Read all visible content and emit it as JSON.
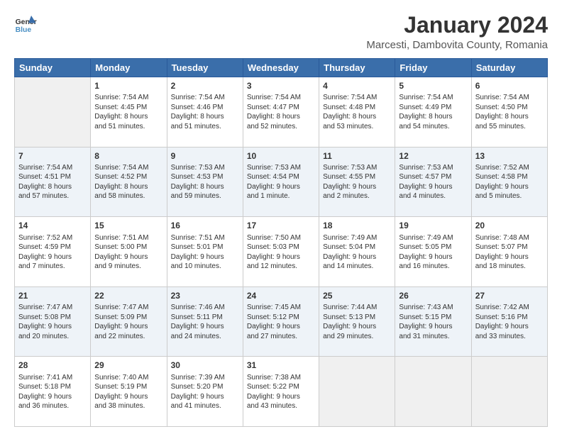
{
  "header": {
    "logo": {
      "line1": "General",
      "line2": "Blue"
    },
    "title": "January 2024",
    "subtitle": "Marcesti, Dambovita County, Romania"
  },
  "calendar": {
    "headers": [
      "Sunday",
      "Monday",
      "Tuesday",
      "Wednesday",
      "Thursday",
      "Friday",
      "Saturday"
    ],
    "weeks": [
      [
        {
          "day": "",
          "info": ""
        },
        {
          "day": "1",
          "info": "Sunrise: 7:54 AM\nSunset: 4:45 PM\nDaylight: 8 hours\nand 51 minutes."
        },
        {
          "day": "2",
          "info": "Sunrise: 7:54 AM\nSunset: 4:46 PM\nDaylight: 8 hours\nand 51 minutes."
        },
        {
          "day": "3",
          "info": "Sunrise: 7:54 AM\nSunset: 4:47 PM\nDaylight: 8 hours\nand 52 minutes."
        },
        {
          "day": "4",
          "info": "Sunrise: 7:54 AM\nSunset: 4:48 PM\nDaylight: 8 hours\nand 53 minutes."
        },
        {
          "day": "5",
          "info": "Sunrise: 7:54 AM\nSunset: 4:49 PM\nDaylight: 8 hours\nand 54 minutes."
        },
        {
          "day": "6",
          "info": "Sunrise: 7:54 AM\nSunset: 4:50 PM\nDaylight: 8 hours\nand 55 minutes."
        }
      ],
      [
        {
          "day": "7",
          "info": "Sunrise: 7:54 AM\nSunset: 4:51 PM\nDaylight: 8 hours\nand 57 minutes."
        },
        {
          "day": "8",
          "info": "Sunrise: 7:54 AM\nSunset: 4:52 PM\nDaylight: 8 hours\nand 58 minutes."
        },
        {
          "day": "9",
          "info": "Sunrise: 7:53 AM\nSunset: 4:53 PM\nDaylight: 8 hours\nand 59 minutes."
        },
        {
          "day": "10",
          "info": "Sunrise: 7:53 AM\nSunset: 4:54 PM\nDaylight: 9 hours\nand 1 minute."
        },
        {
          "day": "11",
          "info": "Sunrise: 7:53 AM\nSunset: 4:55 PM\nDaylight: 9 hours\nand 2 minutes."
        },
        {
          "day": "12",
          "info": "Sunrise: 7:53 AM\nSunset: 4:57 PM\nDaylight: 9 hours\nand 4 minutes."
        },
        {
          "day": "13",
          "info": "Sunrise: 7:52 AM\nSunset: 4:58 PM\nDaylight: 9 hours\nand 5 minutes."
        }
      ],
      [
        {
          "day": "14",
          "info": "Sunrise: 7:52 AM\nSunset: 4:59 PM\nDaylight: 9 hours\nand 7 minutes."
        },
        {
          "day": "15",
          "info": "Sunrise: 7:51 AM\nSunset: 5:00 PM\nDaylight: 9 hours\nand 9 minutes."
        },
        {
          "day": "16",
          "info": "Sunrise: 7:51 AM\nSunset: 5:01 PM\nDaylight: 9 hours\nand 10 minutes."
        },
        {
          "day": "17",
          "info": "Sunrise: 7:50 AM\nSunset: 5:03 PM\nDaylight: 9 hours\nand 12 minutes."
        },
        {
          "day": "18",
          "info": "Sunrise: 7:49 AM\nSunset: 5:04 PM\nDaylight: 9 hours\nand 14 minutes."
        },
        {
          "day": "19",
          "info": "Sunrise: 7:49 AM\nSunset: 5:05 PM\nDaylight: 9 hours\nand 16 minutes."
        },
        {
          "day": "20",
          "info": "Sunrise: 7:48 AM\nSunset: 5:07 PM\nDaylight: 9 hours\nand 18 minutes."
        }
      ],
      [
        {
          "day": "21",
          "info": "Sunrise: 7:47 AM\nSunset: 5:08 PM\nDaylight: 9 hours\nand 20 minutes."
        },
        {
          "day": "22",
          "info": "Sunrise: 7:47 AM\nSunset: 5:09 PM\nDaylight: 9 hours\nand 22 minutes."
        },
        {
          "day": "23",
          "info": "Sunrise: 7:46 AM\nSunset: 5:11 PM\nDaylight: 9 hours\nand 24 minutes."
        },
        {
          "day": "24",
          "info": "Sunrise: 7:45 AM\nSunset: 5:12 PM\nDaylight: 9 hours\nand 27 minutes."
        },
        {
          "day": "25",
          "info": "Sunrise: 7:44 AM\nSunset: 5:13 PM\nDaylight: 9 hours\nand 29 minutes."
        },
        {
          "day": "26",
          "info": "Sunrise: 7:43 AM\nSunset: 5:15 PM\nDaylight: 9 hours\nand 31 minutes."
        },
        {
          "day": "27",
          "info": "Sunrise: 7:42 AM\nSunset: 5:16 PM\nDaylight: 9 hours\nand 33 minutes."
        }
      ],
      [
        {
          "day": "28",
          "info": "Sunrise: 7:41 AM\nSunset: 5:18 PM\nDaylight: 9 hours\nand 36 minutes."
        },
        {
          "day": "29",
          "info": "Sunrise: 7:40 AM\nSunset: 5:19 PM\nDaylight: 9 hours\nand 38 minutes."
        },
        {
          "day": "30",
          "info": "Sunrise: 7:39 AM\nSunset: 5:20 PM\nDaylight: 9 hours\nand 41 minutes."
        },
        {
          "day": "31",
          "info": "Sunrise: 7:38 AM\nSunset: 5:22 PM\nDaylight: 9 hours\nand 43 minutes."
        },
        {
          "day": "",
          "info": ""
        },
        {
          "day": "",
          "info": ""
        },
        {
          "day": "",
          "info": ""
        }
      ]
    ]
  }
}
